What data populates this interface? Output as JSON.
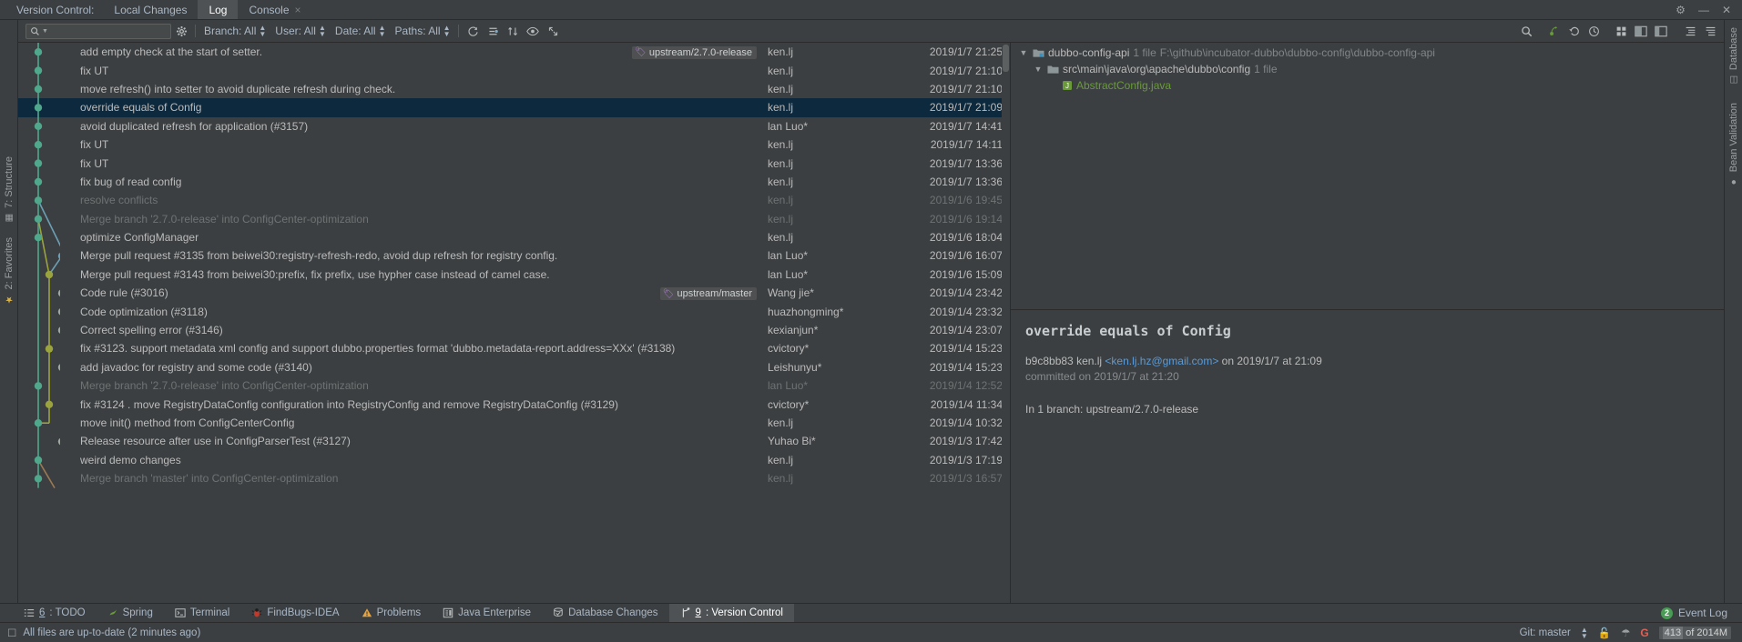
{
  "titlebar": {
    "label": "Version Control:",
    "tabs": [
      {
        "name": "local-changes",
        "label": "Local Changes",
        "active": false,
        "closable": false
      },
      {
        "name": "log",
        "label": "Log",
        "active": true,
        "closable": false
      },
      {
        "name": "console",
        "label": "Console",
        "active": false,
        "closable": true
      }
    ],
    "close_glyph": "×",
    "window_controls": [
      {
        "name": "settings-icon",
        "glyph": "⚙"
      },
      {
        "name": "minimize-icon",
        "glyph": "—"
      },
      {
        "name": "hide-icon",
        "glyph": "✕"
      }
    ]
  },
  "toolbar": {
    "search_placeholder": "",
    "search_value": "",
    "filters": [
      {
        "name": "branch-filter",
        "label": "Branch: All"
      },
      {
        "name": "user-filter",
        "label": "User: All"
      },
      {
        "name": "date-filter",
        "label": "Date: All"
      },
      {
        "name": "paths-filter",
        "label": "Paths: All"
      }
    ],
    "icons": [
      {
        "name": "refresh-icon",
        "title": "Refresh"
      },
      {
        "name": "collapse-icon",
        "title": "Collapse"
      },
      {
        "name": "sort-icon",
        "title": "Intellisort"
      },
      {
        "name": "show-details-icon",
        "title": "Show Details"
      },
      {
        "name": "open-in-editor-icon",
        "title": "Open in Editor"
      }
    ],
    "right_icons": [
      {
        "name": "search-magnifier-icon"
      },
      {
        "name": "cherry-pick-icon"
      },
      {
        "name": "revert-icon"
      },
      {
        "name": "history-icon"
      },
      {
        "name": "group-icon"
      },
      {
        "name": "preview-right-icon"
      },
      {
        "name": "preview-bottom-icon"
      },
      {
        "name": "expand-all-icon"
      },
      {
        "name": "collapse-all-icon"
      }
    ]
  },
  "columns": {
    "subject": "",
    "author": "",
    "date": ""
  },
  "commits": [
    {
      "subject": "add empty check at the start of setter.",
      "author": "ken.lj",
      "date": "2019/1/7 21:25",
      "ref": "upstream/2.7.0-release",
      "dim": false,
      "selected": false,
      "node": {
        "color": "#4fa88b",
        "lane": 1,
        "merge": false
      }
    },
    {
      "subject": "fix UT",
      "author": "ken.lj",
      "date": "2019/1/7 21:10",
      "ref": "",
      "dim": false,
      "selected": false,
      "node": {
        "color": "#4fa88b",
        "lane": 1,
        "merge": false
      }
    },
    {
      "subject": "move refresh() into setter to avoid duplicate refresh during check.",
      "author": "ken.lj",
      "date": "2019/1/7 21:10",
      "ref": "",
      "dim": false,
      "selected": false,
      "node": {
        "color": "#4fa88b",
        "lane": 1,
        "merge": false
      }
    },
    {
      "subject": "override equals of Config",
      "author": "ken.lj",
      "date": "2019/1/7 21:09",
      "ref": "",
      "dim": false,
      "selected": true,
      "node": {
        "color": "#4fa88b",
        "lane": 1,
        "merge": false
      }
    },
    {
      "subject": "avoid duplicated refresh for application (#3157)",
      "author": "lan Luo*",
      "date": "2019/1/7 14:41",
      "ref": "",
      "dim": false,
      "selected": false,
      "node": {
        "color": "#4fa88b",
        "lane": 1,
        "merge": false
      }
    },
    {
      "subject": "fix UT",
      "author": "ken.lj",
      "date": "2019/1/7 14:11",
      "ref": "",
      "dim": false,
      "selected": false,
      "node": {
        "color": "#4fa88b",
        "lane": 1,
        "merge": false
      }
    },
    {
      "subject": "fix UT",
      "author": "ken.lj",
      "date": "2019/1/7 13:36",
      "ref": "",
      "dim": false,
      "selected": false,
      "node": {
        "color": "#4fa88b",
        "lane": 1,
        "merge": false
      }
    },
    {
      "subject": "fix bug of read config",
      "author": "ken.lj",
      "date": "2019/1/7 13:36",
      "ref": "",
      "dim": false,
      "selected": false,
      "node": {
        "color": "#4fa88b",
        "lane": 1,
        "merge": false
      }
    },
    {
      "subject": "resolve conflicts",
      "author": "ken.lj",
      "date": "2019/1/6 19:45",
      "ref": "",
      "dim": true,
      "selected": false,
      "node": {
        "color": "#4fa88b",
        "lane": 1,
        "merge": true
      }
    },
    {
      "subject": "Merge branch '2.7.0-release' into ConfigCenter-optimization",
      "author": "ken.lj",
      "date": "2019/1/6 19:14",
      "ref": "",
      "dim": true,
      "selected": false,
      "node": {
        "color": "#4fa88b",
        "lane": 1,
        "merge": true
      }
    },
    {
      "subject": "optimize ConfigManager",
      "author": "ken.lj",
      "date": "2019/1/6 18:04",
      "ref": "",
      "dim": false,
      "selected": false,
      "node": {
        "color": "#4fa88b",
        "lane": 1,
        "merge": false
      }
    },
    {
      "subject": "Merge pull request #3135 from beiwei30:registry-refresh-redo, avoid dup refresh for registry config.",
      "author": "lan Luo*",
      "date": "2019/1/6 16:07",
      "ref": "",
      "dim": false,
      "selected": false,
      "node": {
        "color": "#6b9fb5",
        "lane": 3,
        "merge": true
      }
    },
    {
      "subject": "Merge pull request #3143 from beiwei30:prefix, fix prefix, use hypher case instead of camel case.",
      "author": "lan Luo*",
      "date": "2019/1/6 15:09",
      "ref": "",
      "dim": false,
      "selected": false,
      "node": {
        "color": "#9aa33e",
        "lane": 2,
        "merge": true
      }
    },
    {
      "subject": "Code rule (#3016)",
      "author": "Wang jie*",
      "date": "2019/1/4 23:42",
      "ref": "upstream/master",
      "dim": false,
      "selected": false,
      "node": {
        "color": "#9da69f",
        "lane": 3,
        "merge": false
      }
    },
    {
      "subject": "Code optimization (#3118)",
      "author": "huazhongming*",
      "date": "2019/1/4 23:32",
      "ref": "",
      "dim": false,
      "selected": false,
      "node": {
        "color": "#9da69f",
        "lane": 3,
        "merge": false
      }
    },
    {
      "subject": "Correct spelling error (#3146)",
      "author": "kexianjun*",
      "date": "2019/1/4 23:07",
      "ref": "",
      "dim": false,
      "selected": false,
      "node": {
        "color": "#9da69f",
        "lane": 3,
        "merge": false
      }
    },
    {
      "subject": "fix #3123.  support metadata xml config and support dubbo.properties format 'dubbo.metadata-report.address=XXx' (#3138)",
      "author": "cvictory*",
      "date": "2019/1/4 15:23",
      "ref": "",
      "dim": false,
      "selected": false,
      "node": {
        "color": "#9aa33e",
        "lane": 2,
        "merge": false
      }
    },
    {
      "subject": "add javadoc for registry and some code (#3140)",
      "author": "Leishunyu*",
      "date": "2019/1/4 15:23",
      "ref": "",
      "dim": false,
      "selected": false,
      "node": {
        "color": "#9da69f",
        "lane": 3,
        "merge": false
      }
    },
    {
      "subject": "Merge branch '2.7.0-release' into ConfigCenter-optimization",
      "author": "lan Luo*",
      "date": "2019/1/4 12:52",
      "ref": "",
      "dim": true,
      "selected": false,
      "node": {
        "color": "#4fa88b",
        "lane": 1,
        "merge": true
      }
    },
    {
      "subject": "fix #3124 . move RegistryDataConfig configuration into RegistryConfig and remove RegistryDataConfig (#3129)",
      "author": "cvictory*",
      "date": "2019/1/4 11:34",
      "ref": "",
      "dim": false,
      "selected": false,
      "node": {
        "color": "#9aa33e",
        "lane": 2,
        "merge": false
      }
    },
    {
      "subject": "move init() method from ConfigCenterConfig",
      "author": "ken.lj",
      "date": "2019/1/4 10:32",
      "ref": "",
      "dim": false,
      "selected": false,
      "node": {
        "color": "#4fa88b",
        "lane": 1,
        "merge": false
      }
    },
    {
      "subject": "Release resource after use in ConfigParserTest (#3127)",
      "author": "Yuhao Bi*",
      "date": "2019/1/3 17:42",
      "ref": "",
      "dim": false,
      "selected": false,
      "node": {
        "color": "#9da69f",
        "lane": 3,
        "merge": false
      }
    },
    {
      "subject": "weird demo changes",
      "author": "ken.lj",
      "date": "2019/1/3 17:19",
      "ref": "",
      "dim": false,
      "selected": false,
      "node": {
        "color": "#4fa88b",
        "lane": 1,
        "merge": false
      }
    },
    {
      "subject": "Merge branch 'master' into ConfigCenter-optimization",
      "author": "ken.lj",
      "date": "2019/1/3 16:57",
      "ref": "",
      "dim": true,
      "selected": false,
      "node": {
        "color": "#4fa88b",
        "lane": 1,
        "merge": true
      }
    }
  ],
  "file_tree": [
    {
      "name": "module-node",
      "indent": 0,
      "arrow": "▼",
      "icon": "module-icon",
      "label": "dubbo-config-api",
      "meta_count": "1 file",
      "meta_path": "F:\\github\\incubator-dubbo\\dubbo-config\\dubbo-config-api",
      "java": false
    },
    {
      "name": "folder-node",
      "indent": 1,
      "arrow": "▼",
      "icon": "folder-icon",
      "label": "src\\main\\java\\org\\apache\\dubbo\\config",
      "meta_count": "1 file",
      "meta_path": "",
      "java": false
    },
    {
      "name": "file-node",
      "indent": 2,
      "arrow": "",
      "icon": "java-file-icon",
      "label": "AbstractConfig.java",
      "meta_count": "",
      "meta_path": "",
      "java": true
    }
  ],
  "detail": {
    "subject": "override equals of Config",
    "hash": "b9c8bb83",
    "author": "ken.lj",
    "email": "<ken.lj.hz@gmail.com>",
    "authored": "on 2019/1/7 at 21:09",
    "committed": "committed on 2019/1/7 at 21:20",
    "branches": "In 1 branch: upstream/2.7.0-release"
  },
  "left_strip": [
    {
      "name": "structure-tool-button",
      "label": "7: Structure",
      "icon": "structure-icon"
    },
    {
      "name": "favorites-tool-button",
      "label": "2: Favorites",
      "icon": "star-icon"
    }
  ],
  "right_strip": [
    {
      "name": "database-tool-button",
      "label": "Database",
      "icon": "database-icon"
    },
    {
      "name": "bean-validation-tool-button",
      "label": "Bean Validation",
      "icon": "bean-icon"
    }
  ],
  "tool_windows": [
    {
      "name": "tw-todo",
      "num": "6",
      "label": ": TODO",
      "icon": "todo-icon",
      "active": false
    },
    {
      "name": "tw-spring",
      "num": "",
      "label": "Spring",
      "icon": "spring-icon",
      "active": false
    },
    {
      "name": "tw-terminal",
      "num": "",
      "label": "Terminal",
      "icon": "terminal-icon",
      "active": false
    },
    {
      "name": "tw-findbugs",
      "num": "",
      "label": "FindBugs-IDEA",
      "icon": "findbugs-icon",
      "active": false
    },
    {
      "name": "tw-problems",
      "num": "",
      "label": "Problems",
      "icon": "warning-icon",
      "active": false
    },
    {
      "name": "tw-java-enterprise",
      "num": "",
      "label": "Java Enterprise",
      "icon": "java-enterprise-icon",
      "active": false
    },
    {
      "name": "tw-database-changes",
      "num": "",
      "label": "Database Changes",
      "icon": "db-changes-icon",
      "active": false
    },
    {
      "name": "tw-version-control",
      "num": "9",
      "label": ": Version Control",
      "icon": "branch-icon",
      "active": true
    }
  ],
  "event_log": {
    "count": "2",
    "label": "Event Log"
  },
  "status": {
    "message": "All files are up-to-date (2 minutes ago)",
    "git_label": "Git: master",
    "memory_used": "413",
    "memory_total": " of 2014M",
    "lock_icon": "lock-open-icon",
    "hat_icon": "hector-icon",
    "google_icon": "G"
  },
  "colors": {
    "selection": "#0d293e",
    "accent_link": "#5b9ad6",
    "lane_green": "#4fa88b",
    "lane_olive": "#9aa33e",
    "lane_grey": "#9da69f",
    "lane_blue": "#6b9fb5",
    "lane_brown": "#9a7a52",
    "tag_purple": "#b07ad1"
  }
}
